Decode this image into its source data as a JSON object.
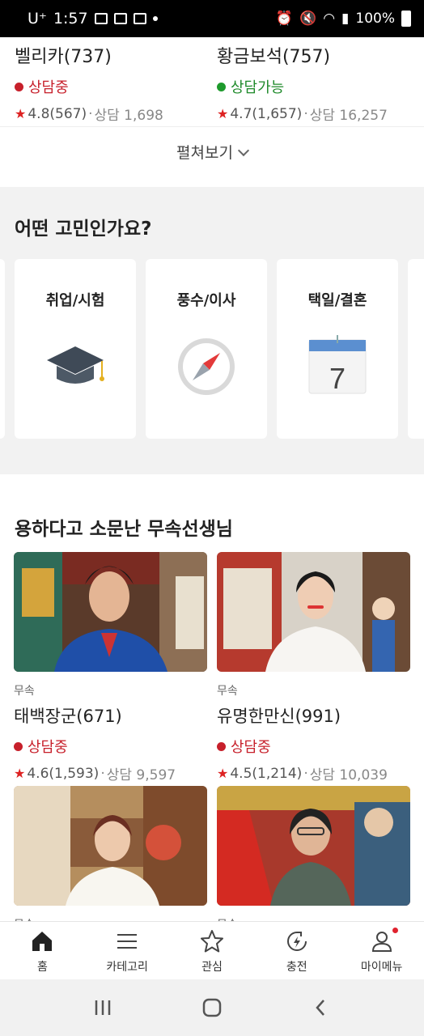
{
  "status_bar": {
    "carrier": "U⁺",
    "time": "1:57",
    "battery": "100%"
  },
  "top_cards": [
    {
      "name": "벨리카(737)",
      "status": "상담중",
      "status_type": "busy",
      "rating": "4.8(567)",
      "sep": " · ",
      "consult": "상담 1,698"
    },
    {
      "name": "황금보석(757)",
      "status": "상담가능",
      "status_type": "free",
      "rating": "4.7(1,657)",
      "sep": " · ",
      "consult": "상담 16,257"
    }
  ],
  "expand_label": "펼쳐보기",
  "worry": {
    "title": "어떤 고민인가요?",
    "cards": [
      {
        "label": "취업/시험",
        "icon": "graduation-cap-icon"
      },
      {
        "label": "풍수/이사",
        "icon": "compass-icon"
      },
      {
        "label": "택일/결혼",
        "icon": "calendar-icon",
        "icon_text": "7"
      }
    ]
  },
  "shaman": {
    "title": "용하다고 소문난 무속선생님",
    "cards": [
      {
        "category": "무속",
        "name": "태백장군(671)",
        "status": "상담중",
        "status_type": "busy",
        "rating": "4.6(1,593)",
        "sep": " · ",
        "consult": "상담 9,597"
      },
      {
        "category": "무속",
        "name": "유명한만신(991)",
        "status": "상담중",
        "status_type": "busy",
        "rating": "4.5(1,214)",
        "sep": " · ",
        "consult": "상담 10,039"
      },
      {
        "category": "무속"
      },
      {
        "category": "무속"
      }
    ]
  },
  "nav": [
    {
      "label": "홈",
      "icon": "home-icon"
    },
    {
      "label": "카테고리",
      "icon": "menu-icon"
    },
    {
      "label": "관심",
      "icon": "star-icon"
    },
    {
      "label": "충전",
      "icon": "charge-icon"
    },
    {
      "label": "마이메뉴",
      "icon": "profile-icon"
    }
  ],
  "colors": {
    "busy": "#c7202b",
    "free": "#1e9a2c",
    "star": "#dd2222"
  }
}
